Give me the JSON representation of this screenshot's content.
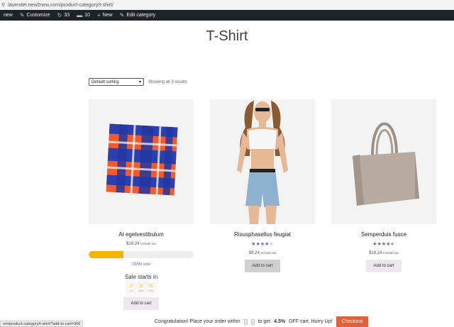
{
  "browser": {
    "url": "lavender.new2new.com/product-category/t-shirt/"
  },
  "adminbar": {
    "site": "new",
    "customize": "Customize",
    "updates": "33",
    "comments": "10",
    "new": "New",
    "edit": "Edit category"
  },
  "page": {
    "title": "T-Shirt"
  },
  "toolbar": {
    "sorting": "Default sorting",
    "result_count": "Showing all 3 results"
  },
  "products": [
    {
      "name": "At egetvestibulum",
      "price": "$18.24",
      "tax": "Include tax",
      "rating": 0,
      "progress_fraction": 0.33,
      "sold": "33/99 sold",
      "sale_label": "Sale starts in",
      "countdown": [
        {
          "v": "02",
          "u": "Hrs"
        },
        {
          "v": "26",
          "u": "Mins"
        },
        {
          "v": "55",
          "u": "Secs"
        }
      ],
      "button": "Add to cart"
    },
    {
      "name": "Risusphasellus feugiat",
      "price": "$8.24",
      "tax": "Include tax",
      "rating": 4,
      "button": "Add to cart"
    },
    {
      "name": "Semperduis fusce",
      "price": "$18.24",
      "tax": "Include tax",
      "rating": 4.5,
      "button": "Add to cart"
    }
  ],
  "statusbar": {
    "link": "om/product-category/t-shirt/?add-to-cart=306"
  },
  "notice": {
    "text_a": "Congratulation! Place your order within",
    "text_b": "to get",
    "percent": "4.5%",
    "text_c": "OFF cart. Hurry Up!",
    "checkout": "Checkout"
  },
  "colors": {
    "accent": "#7f54b3",
    "progress": "#f7b500",
    "checkout": "#e2603a",
    "adminbar": "#1d2327"
  }
}
